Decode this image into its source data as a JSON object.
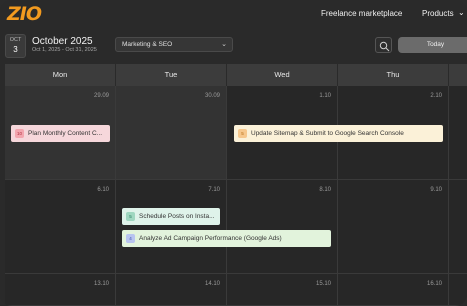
{
  "nav": {
    "logo": "ZIO",
    "links": [
      "Freelance marketplace",
      "Products"
    ]
  },
  "header": {
    "badge_month": "OCT",
    "badge_day": "3",
    "title": "October 2025",
    "subtitle": "Oct 1, 2025 - Oct 31, 2025",
    "category_select": "Marketing & SEO",
    "today_label": "Today"
  },
  "calendar": {
    "days": [
      "Mon",
      "Tue",
      "Wed",
      "Thu"
    ],
    "week1": [
      "29.09",
      "30.09",
      "1.10",
      "2.10"
    ],
    "week2": [
      "6.10",
      "7.10",
      "8.10",
      "9.10"
    ],
    "week3": [
      "13.10",
      "14.10",
      "15.10",
      "16.10"
    ]
  },
  "events": [
    {
      "icon_text": "10",
      "title": "Plan Monthly Content C...",
      "bg": "#f6d7db",
      "icon_bg": "#f3a6af",
      "icon_color": "#b03040"
    },
    {
      "icon_text": "5",
      "title": "Update Sitemap & Submit to Google Search Console",
      "bg": "#fbf1d8",
      "icon_bg": "#f6c78c",
      "icon_color": "#b56a10"
    },
    {
      "icon_text": "5",
      "title": "Schedule Posts on Insta...",
      "bg": "#dff3ea",
      "icon_bg": "#9fd7c0",
      "icon_color": "#247a5c"
    },
    {
      "icon_text": "4",
      "title": "Analyze Ad Campaign Performance (Google Ads)",
      "bg": "#e2f3dc",
      "icon_bg": "#b8c4f0",
      "icon_color": "#3c4fa8"
    }
  ],
  "colors": {
    "brand": "#f29a1f"
  }
}
